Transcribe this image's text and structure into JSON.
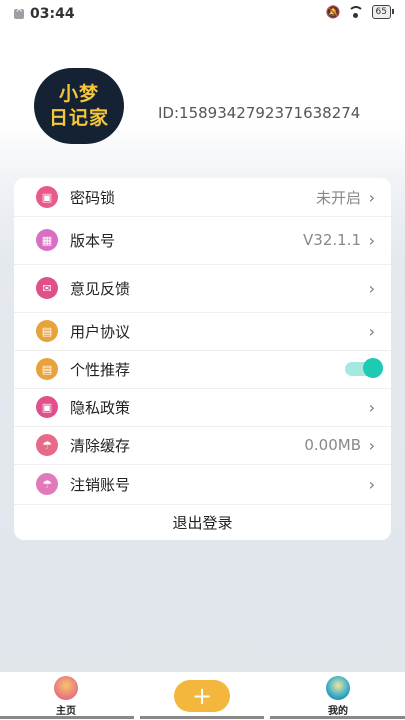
{
  "status_bar": {
    "time": "03:44",
    "battery": "65"
  },
  "profile": {
    "logo_line1": "小梦",
    "logo_line2": "日记家",
    "user_id": "ID:1589342792371638274"
  },
  "settings": {
    "items": [
      {
        "label": "密码锁",
        "value": "未开启",
        "icon": "lock-icon",
        "icon_color": "#e85a8a"
      },
      {
        "label": "版本号",
        "value": "V32.1.1",
        "icon": "version-icon",
        "icon_color": "#d96fc5"
      },
      {
        "label": "意见反馈",
        "value": "",
        "icon": "feedback-icon",
        "icon_color": "#e0508a"
      },
      {
        "label": "用户协议",
        "value": "",
        "icon": "agreement-icon",
        "icon_color": "#e8a23c"
      },
      {
        "label": "个性推荐",
        "value": "",
        "icon": "recommend-icon",
        "icon_color": "#e8a23c",
        "toggle_on": true
      },
      {
        "label": "隐私政策",
        "value": "",
        "icon": "privacy-icon",
        "icon_color": "#e0508a"
      },
      {
        "label": "清除缓存",
        "value": "0.00MB",
        "icon": "clear-cache-icon",
        "icon_color": "#e86a8a"
      },
      {
        "label": "注销账号",
        "value": "",
        "icon": "cancel-account-icon",
        "icon_color": "#e07ab8"
      }
    ],
    "logout": "退出登录"
  },
  "tabbar": {
    "home": "主页",
    "mine": "我的",
    "add_icon": "plus-icon"
  },
  "colors": {
    "accent": "#1fcab4",
    "add_button": "#f4b73e"
  }
}
